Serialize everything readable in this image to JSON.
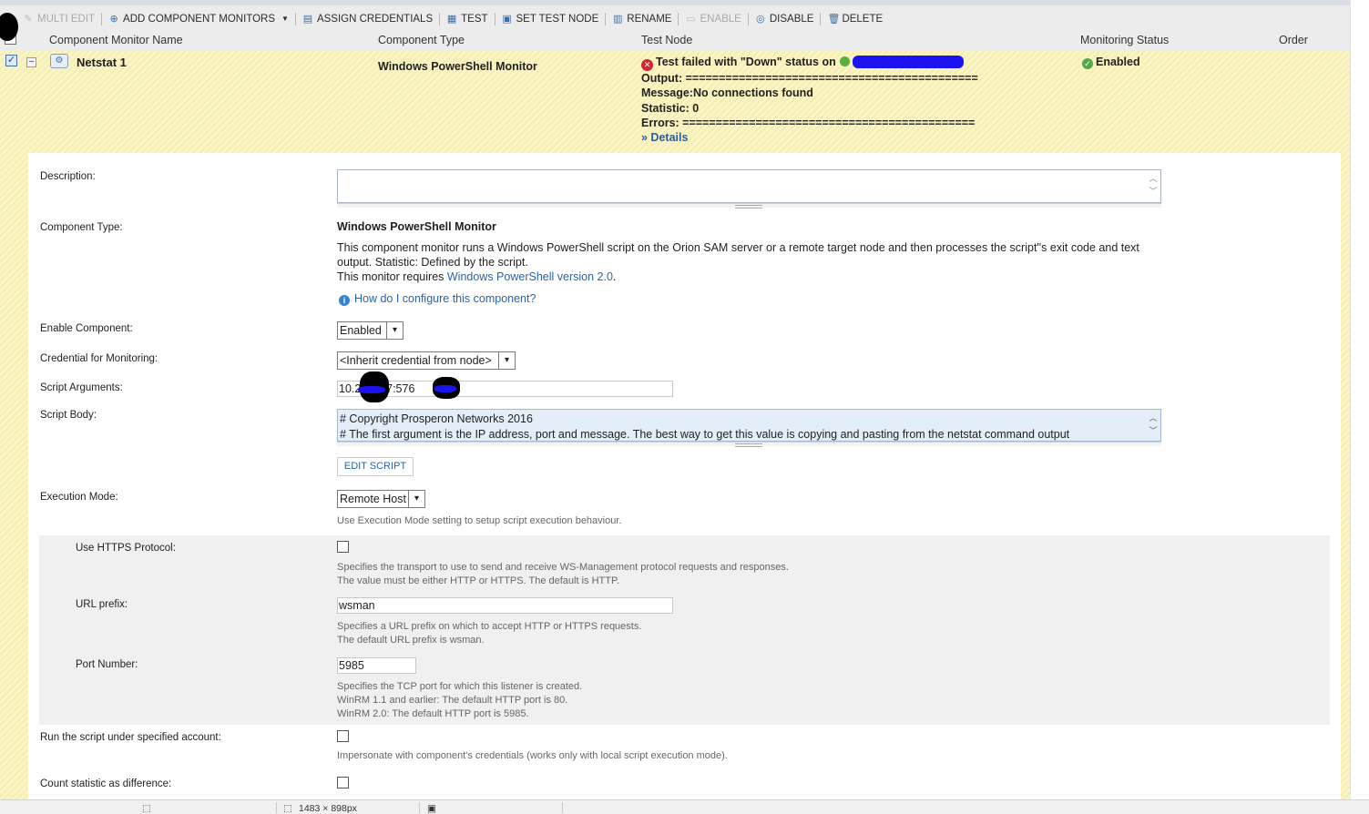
{
  "toolbar": {
    "multi_edit": "MULTI EDIT",
    "add_component_monitors": "ADD COMPONENT MONITORS",
    "assign_credentials": "ASSIGN CREDENTIALS",
    "test": "TEST",
    "set_test_node": "SET TEST NODE",
    "rename": "RENAME",
    "enable": "ENABLE",
    "disable": "DISABLE",
    "delete": "DELETE"
  },
  "columns": {
    "name": "Component Monitor Name",
    "type": "Component Type",
    "test_node": "Test Node",
    "status": "Monitoring Status",
    "order": "Order"
  },
  "monitor": {
    "name": "Netstat 1",
    "type": "Windows PowerShell Monitor",
    "test_result": "Test failed with \"Down\" status on",
    "output_line": "Output: ============================================",
    "message_line": "Message:No connections found",
    "statistic_line": "Statistic: 0",
    "errors_line": "Errors: ============================================",
    "details_link": "» Details",
    "status": "Enabled"
  },
  "form": {
    "description_label": "Description:",
    "description_value": "",
    "component_type_label": "Component Type:",
    "component_type_name": "Windows PowerShell Monitor",
    "component_desc_1": "This component monitor runs a Windows PowerShell script on the Orion SAM server or a remote target node and then processes the script''s exit code and text output. Statistic: Defined by the script.",
    "component_desc_2_prefix": "This monitor requires ",
    "component_desc_2_link": "Windows PowerShell version 2.0",
    "component_desc_2_suffix": ".",
    "help_link": "How do I configure this component?",
    "enable_label": "Enable Component:",
    "enable_value": "Enabled",
    "credential_label": "Credential for Monitoring:",
    "credential_value": "<Inherit credential from node>",
    "script_args_label": "Script Arguments:",
    "script_args_value": "10.2        4.247:576",
    "script_body_label": "Script Body:",
    "script_body_line1": "# Copyright Prosperon Networks 2016",
    "script_body_line2": "# The first argument is the IP address, port and message. The best way to get this value is copying and pasting from the netstat command output",
    "edit_script_button": "EDIT SCRIPT",
    "execution_mode_label": "Execution Mode:",
    "execution_mode_value": "Remote Host",
    "execution_mode_hint": "Use Execution Mode setting to setup script execution behaviour.",
    "https_label": "Use HTTPS Protocol:",
    "https_hint_1": "Specifies the transport to use to send and receive WS-Management protocol requests and responses.",
    "https_hint_2": "The value must be either HTTP or HTTPS. The default is HTTP.",
    "url_prefix_label": "URL prefix:",
    "url_prefix_value": "wsman",
    "url_prefix_hint_1": "Specifies a URL prefix on which to accept HTTP or HTTPS requests.",
    "url_prefix_hint_2": "The default URL prefix is wsman.",
    "port_label": "Port Number:",
    "port_value": "5985",
    "port_hint_1": "Specifies the TCP port for which this listener is created.",
    "port_hint_2": "WinRM 1.1 and earlier: The default HTTP port is 80.",
    "port_hint_3": "WinRM 2.0: The default HTTP port is 5985.",
    "run_account_label": "Run the script under specified account:",
    "run_account_hint": "Impersonate with component's credentials (works only with local script execution mode).",
    "count_diff_label": "Count statistic as difference:"
  },
  "statusbar": {
    "dimensions": "1483 × 898px"
  },
  "colors": {
    "row_highlight": "#fbf5c6",
    "link": "#2a63ad",
    "error_red": "#d8262f",
    "ok_green": "#55a84a",
    "redaction_blue": "#1c14f0"
  }
}
